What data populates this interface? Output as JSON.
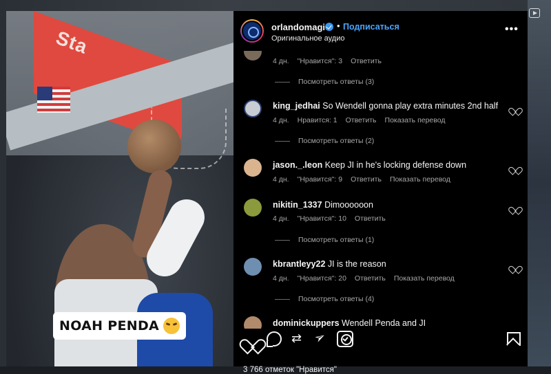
{
  "video": {
    "caption": "NOAH PENDA",
    "caption_emoji": "tired-face-emoji",
    "backboard_text": "Sta"
  },
  "post": {
    "username": "orlandomagic",
    "follow_label": "Подписаться",
    "separator": "•",
    "audio_label": "Оригинальное аудио",
    "more_label": "•••"
  },
  "comments": [
    {
      "user": "",
      "text": "",
      "time": "4 дн.",
      "likes": "\"Нравится\": 3",
      "reply": "Ответить",
      "translate": "",
      "replies": "Посмотреть ответы (3)",
      "avatar_color": "#7a6a5a"
    },
    {
      "user": "king_jedhai",
      "text": "So Wendell gonna play extra minutes 2nd half",
      "time": "4 дн.",
      "likes": "Нравится: 1",
      "reply": "Ответить",
      "translate": "Показать перевод",
      "replies": "Посмотреть ответы (2)",
      "avatar_color": "#c8cdd4"
    },
    {
      "user": "jason._.leon",
      "text": "Keep JI in he's locking defense down",
      "time": "4 дн.",
      "likes": "\"Нравится\": 9",
      "reply": "Ответить",
      "translate": "Показать перевод",
      "replies": "",
      "avatar_color": "#d9b48f"
    },
    {
      "user": "nikitin_1337",
      "text": "Dimoooooon",
      "time": "4 дн.",
      "likes": "\"Нравится\": 10",
      "reply": "Ответить",
      "translate": "",
      "replies": "Посмотреть ответы (1)",
      "avatar_color": "#8a9a3c"
    },
    {
      "user": "kbrantleyy22",
      "text": "JI is the reason",
      "time": "4 дн.",
      "likes": "\"Нравится\": 20",
      "reply": "Ответить",
      "translate": "Показать перевод",
      "replies": "Посмотреть ответы (4)",
      "avatar_color": "#6f8fb0"
    },
    {
      "user": "dominickuppers",
      "text": "Wendell Penda and JI",
      "time": "",
      "likes": "",
      "reply": "",
      "translate": "",
      "replies": "",
      "avatar_color": "#b08a6a"
    }
  ],
  "actions": {
    "likes_count": "3 766 отметок \"Нравится\""
  },
  "colors": {
    "accent_link": "#4aa6ff",
    "verified": "#3897f0",
    "panel_bg": "#000000",
    "muted_text": "#a8a8a8"
  },
  "icons": [
    "like-icon",
    "comment-icon",
    "repost-icon",
    "share-icon",
    "save-reel-icon",
    "bookmark-icon",
    "more-icon",
    "verified-icon",
    "reels-icon"
  ]
}
